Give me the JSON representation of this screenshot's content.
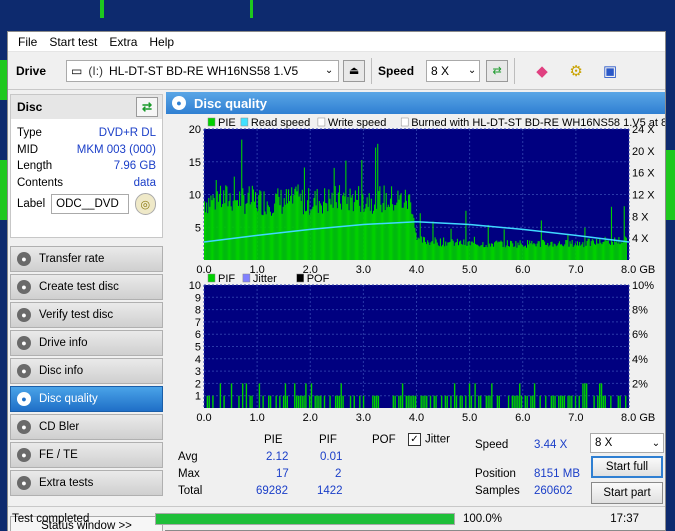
{
  "menu": [
    "File",
    "Start test",
    "Extra",
    "Help"
  ],
  "toolbar": {
    "drive_label": "Drive",
    "drive_letter": "(I:)",
    "drive_name": "HL-DT-ST BD-RE  WH16NS58 1.V5",
    "speed_label": "Speed",
    "speed_value": "8 X"
  },
  "disc": {
    "title": "Disc",
    "rows": [
      {
        "k": "Type",
        "v": "DVD+R DL"
      },
      {
        "k": "MID",
        "v": "MKM 003 (000)"
      },
      {
        "k": "Length",
        "v": "7.96 GB"
      },
      {
        "k": "Contents",
        "v": "data"
      }
    ],
    "label_key": "Label",
    "label_value": "ODC__DVD"
  },
  "nav": [
    {
      "label": "Transfer rate",
      "active": false
    },
    {
      "label": "Create test disc",
      "active": false
    },
    {
      "label": "Verify test disc",
      "active": false
    },
    {
      "label": "Drive info",
      "active": false
    },
    {
      "label": "Disc info",
      "active": false
    },
    {
      "label": "Disc quality",
      "active": true
    },
    {
      "label": "CD Bler",
      "active": false
    },
    {
      "label": "FE / TE",
      "active": false
    },
    {
      "label": "Extra tests",
      "active": false
    }
  ],
  "status_window": "Status window >>",
  "panel_title": "Disc quality",
  "chart_data": [
    {
      "type": "area",
      "legend": [
        "PIE",
        "Read speed",
        "Write speed",
        "Burned with HL-DT-ST BD-RE  WH16NS58 1.V5 at 8X"
      ],
      "legend_colors": [
        "#00d000",
        "#40e0ff",
        "#ffffff",
        "#ffffff"
      ],
      "x_ticks": [
        "0.0",
        "1.0",
        "2.0",
        "3.0",
        "4.0",
        "5.0",
        "6.0",
        "7.0",
        "8.0 GB"
      ],
      "y_ticks_left": [
        "5",
        "10",
        "15",
        "20"
      ],
      "y_ticks_right": [
        "4 X",
        "8 X",
        "12 X",
        "16 X",
        "20 X",
        "24 X"
      ],
      "xlim": [
        0,
        8
      ],
      "ylim": [
        0,
        20
      ],
      "pie_profile": {
        "x": [
          0.0,
          0.5,
          1.0,
          2.0,
          3.0,
          3.9,
          4.0,
          5.0,
          6.0,
          7.0,
          7.9
        ],
        "y": [
          9,
          9.5,
          9,
          9,
          9.5,
          9,
          3,
          2.5,
          2.5,
          2.5,
          3
        ]
      },
      "read_speed": {
        "x": [
          0,
          1,
          2,
          3,
          4,
          5,
          6,
          7,
          8
        ],
        "y_x": [
          3.3,
          4.5,
          5.6,
          6.5,
          7.0,
          6.5,
          5.6,
          4.5,
          3.3
        ]
      }
    },
    {
      "type": "bar",
      "legend": [
        "PIF",
        "Jitter",
        "POF"
      ],
      "legend_colors": [
        "#00d000",
        "#8080ff",
        "#000000"
      ],
      "x_ticks": [
        "0.0",
        "1.0",
        "2.0",
        "3.0",
        "4.0",
        "5.0",
        "6.0",
        "7.0",
        "8.0 GB"
      ],
      "y_ticks_left": [
        "1",
        "2",
        "3",
        "4",
        "5",
        "6",
        "7",
        "8",
        "9",
        "10"
      ],
      "y_ticks_right": [
        "2%",
        "4%",
        "6%",
        "8%",
        "10%"
      ],
      "xlim": [
        0,
        8
      ],
      "ylim": [
        0,
        10
      ],
      "pif_max": 2
    }
  ],
  "stats": {
    "headers": [
      "PIE",
      "PIF",
      "POF",
      "Jitter"
    ],
    "avg_label": "Avg",
    "avg_pie": "2.12",
    "avg_pif": "0.01",
    "max_label": "Max",
    "max_pie": "17",
    "max_pif": "2",
    "total_label": "Total",
    "total_pie": "69282",
    "total_pif": "1422",
    "speed_label": "Speed",
    "speed_value": "3.44 X",
    "position_label": "Position",
    "position_value": "8151 MB",
    "samples_label": "Samples",
    "samples_value": "260602",
    "speed_select": "8 X",
    "start_full": "Start full",
    "start_part": "Start part"
  },
  "statusbar": {
    "text": "Test completed",
    "progress": 100,
    "percent": "100.0%",
    "time": "17:37"
  }
}
